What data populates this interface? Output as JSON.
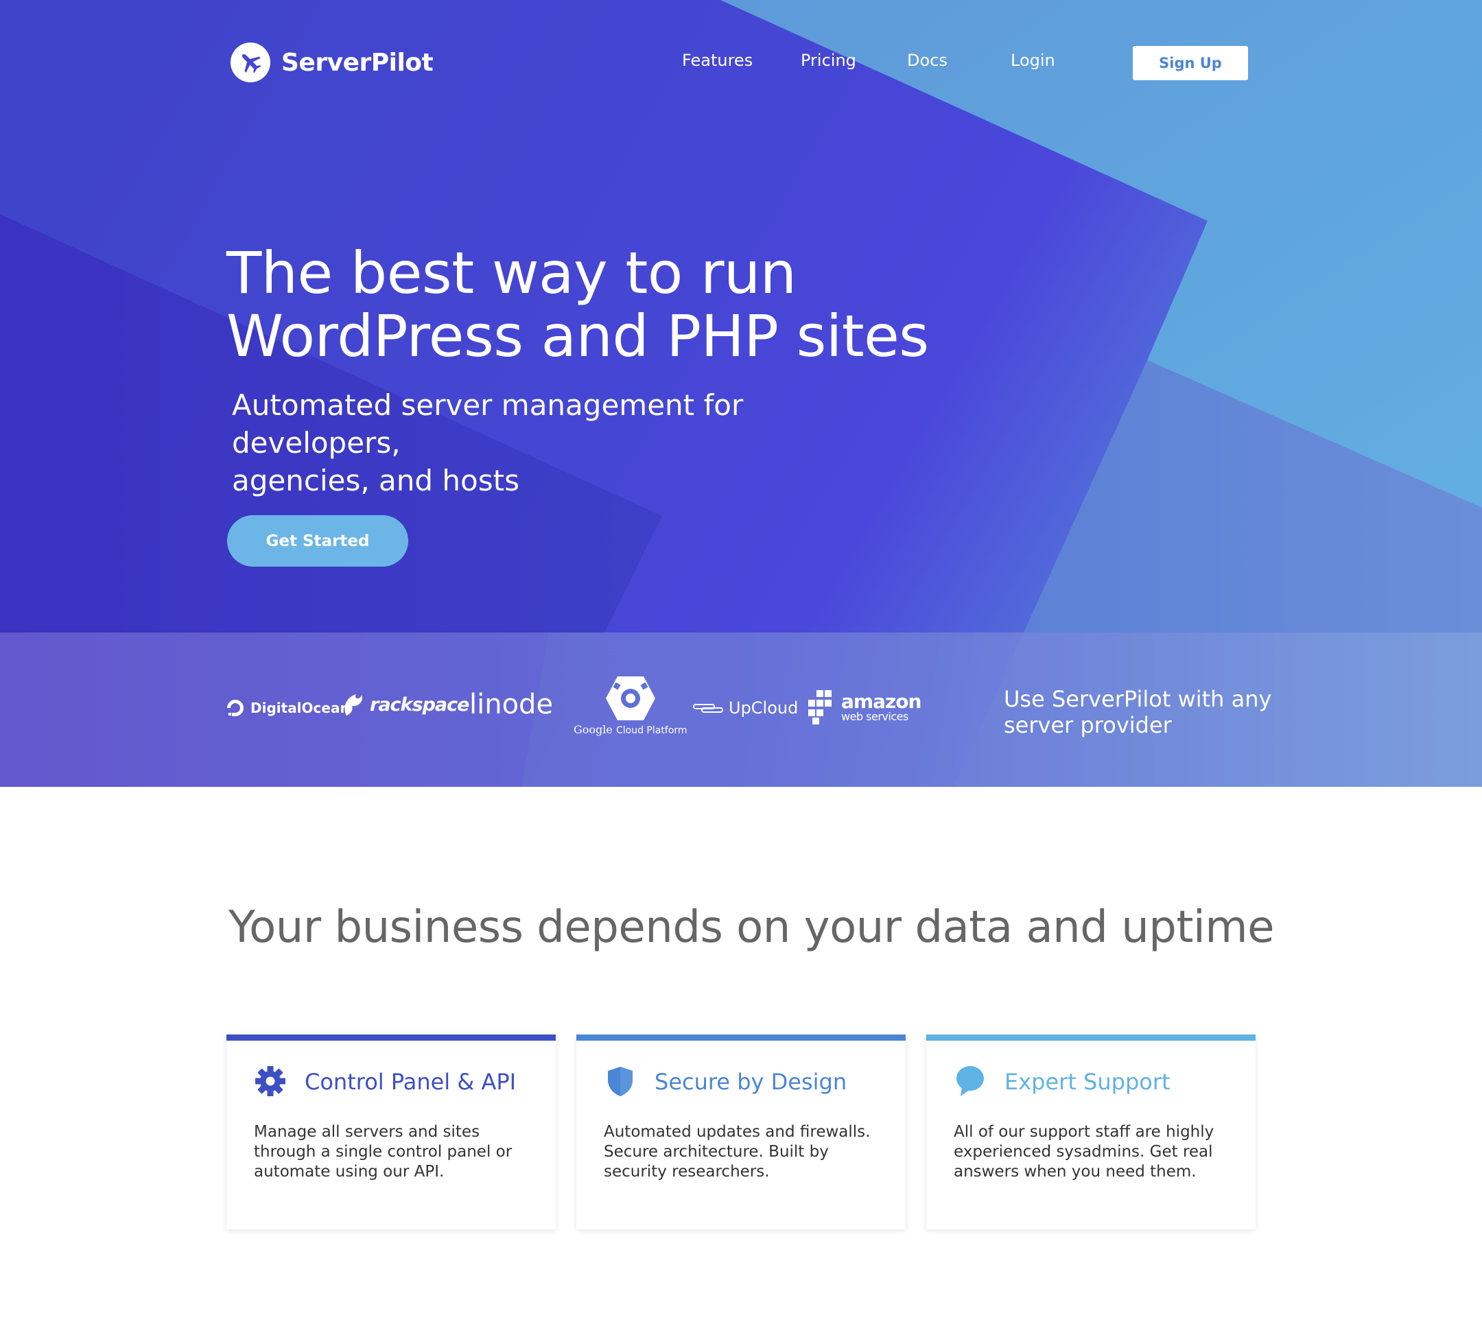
{
  "brand": {
    "name": "ServerPilot"
  },
  "nav": {
    "features": "Features",
    "pricing": "Pricing",
    "docs": "Docs",
    "login": "Login",
    "signup": "Sign Up"
  },
  "hero": {
    "headline_line1": "The best way to run",
    "headline_line2": "WordPress and PHP sites",
    "subhead_line1": "Automated server management for developers,",
    "subhead_line2": "agencies, and hosts",
    "cta": "Get Started"
  },
  "providers": {
    "logos": {
      "digitalocean": "DigitalOcean",
      "rackspace": "rackspace",
      "linode": "linode",
      "google": "Google",
      "google_sub": "Cloud Platform",
      "upcloud": "UpCloud",
      "amazon": "amazon",
      "amazon_sub": "web services"
    },
    "note_line1": "Use ServerPilot with any",
    "note_line2": "server provider"
  },
  "features": {
    "title": "Your business depends on your data and uptime",
    "cards": [
      {
        "title": "Control Panel & API",
        "icon": "gear-icon",
        "color": "#3d4fc4",
        "desc": "Manage all servers and sites through a single control panel or automate using our API."
      },
      {
        "title": "Secure by Design",
        "icon": "shield-icon",
        "color": "#4a86d4",
        "desc": "Automated updates and firewalls. Secure architecture. Built by security researchers."
      },
      {
        "title": "Expert Support",
        "icon": "chat-bubble-icon",
        "color": "#5fb2e4",
        "desc": "All of our support staff are highly experienced sysadmins. Get real answers when you need them."
      }
    ]
  },
  "colors": {
    "hero_primary": "#4546d3",
    "hero_light": "#62a8e0",
    "cta": "#6bb6e6",
    "heading_gray": "#666666"
  }
}
